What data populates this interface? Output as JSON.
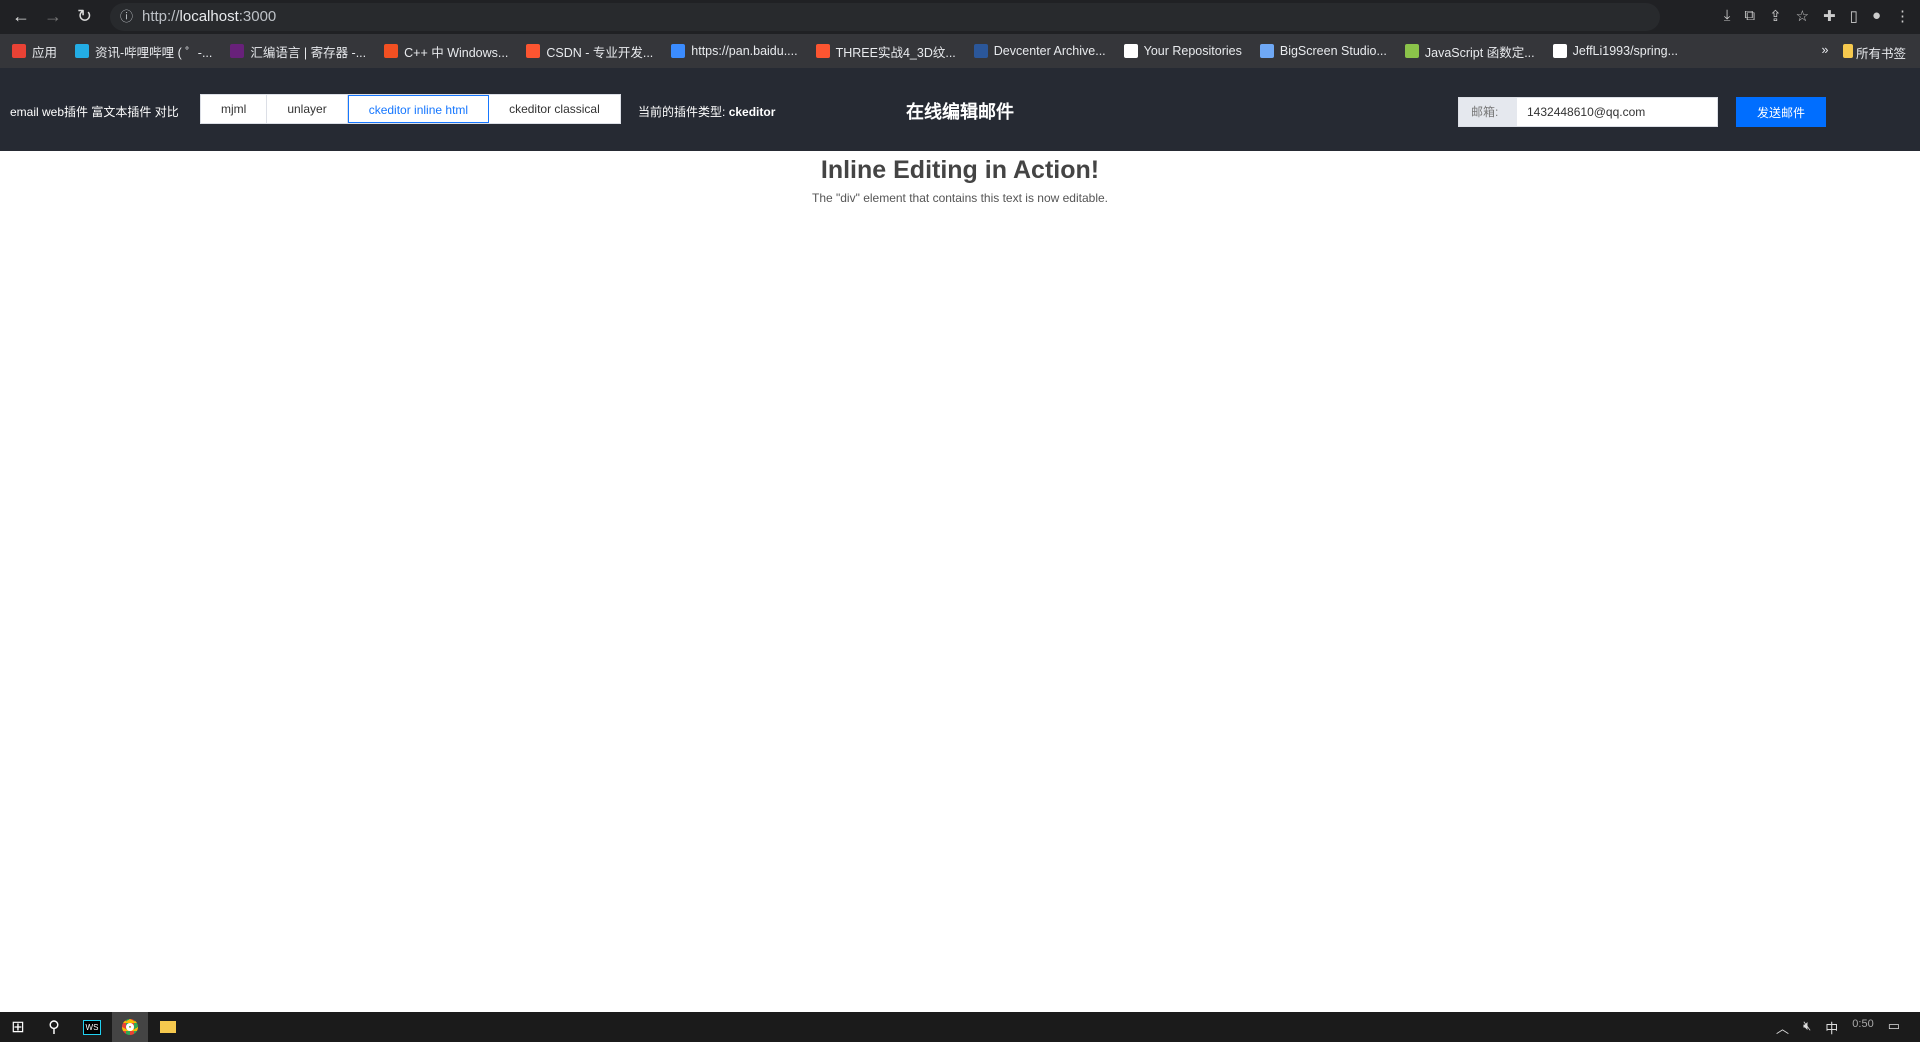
{
  "browser": {
    "url_scheme": "http://",
    "url_host": "localhost",
    "url_port": ":3000",
    "bookmarks": [
      {
        "label": "应用",
        "color": "#e94235"
      },
      {
        "label": "资讯-哔哩哔哩 ( ゜-...",
        "color": "#23ade5"
      },
      {
        "label": "汇编语言 | 寄存器 -...",
        "color": "#68217a"
      },
      {
        "label": "C++ 中 Windows...",
        "color": "#f25022"
      },
      {
        "label": "CSDN - 专业开发...",
        "color": "#fc5531"
      },
      {
        "label": "https://pan.baidu....",
        "color": "#3b8cff"
      },
      {
        "label": "THREE实战4_3D纹...",
        "color": "#fc5531"
      },
      {
        "label": "Devcenter Archive...",
        "color": "#2b579a"
      },
      {
        "label": "Your Repositories",
        "color": "#ffffff"
      },
      {
        "label": "BigScreen Studio...",
        "color": "#6fa8f5"
      },
      {
        "label": "JavaScript 函数定...",
        "color": "#8bc34a"
      },
      {
        "label": "JeffLi1993/spring...",
        "color": "#ffffff"
      }
    ],
    "more": "»",
    "all_bookmarks": "所有书签"
  },
  "header": {
    "brand": "email web插件 富文本插件 对比",
    "tabs": [
      "mjml",
      "unlayer",
      "ckeditor inline html",
      "ckeditor classical"
    ],
    "active_tab": 2,
    "current_label": "当前的插件类型:",
    "current_value": "ckeditor",
    "title": "在线编辑邮件",
    "email_label": "邮箱:",
    "email_value": "1432448610@qq.com",
    "send": "发送邮件",
    "accent": "#006eff"
  },
  "content": {
    "heading": "Inline Editing in Action!",
    "text": "The \"div\" element that contains this text is now editable."
  },
  "taskbar": {
    "ime": "中",
    "clock": "0:50"
  }
}
